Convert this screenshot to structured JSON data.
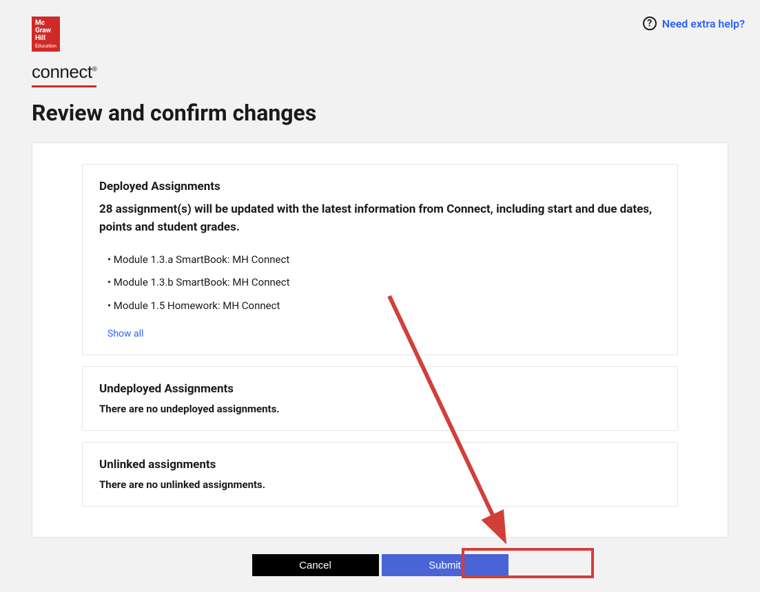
{
  "header": {
    "logo_lines": "Mc\nGraw\nHill\nEducation",
    "brand": "connect",
    "help_label": "Need extra help?"
  },
  "page_title": "Review and confirm changes",
  "deployed": {
    "title": "Deployed Assignments",
    "description": "28 assignment(s) will be updated with the latest information from Connect, including start and due dates, points and student grades.",
    "items": [
      "Module 1.3.a SmartBook: MH Connect",
      "Module 1.3.b SmartBook: MH Connect",
      "Module 1.5 Homework: MH Connect"
    ],
    "show_all_label": "Show all"
  },
  "undeployed": {
    "title": "Undeployed Assignments",
    "empty_text": "There are no undeployed assignments."
  },
  "unlinked": {
    "title": "Unlinked assignments",
    "empty_text": "There are no unlinked assignments."
  },
  "buttons": {
    "cancel": "Cancel",
    "submit": "Submit"
  }
}
